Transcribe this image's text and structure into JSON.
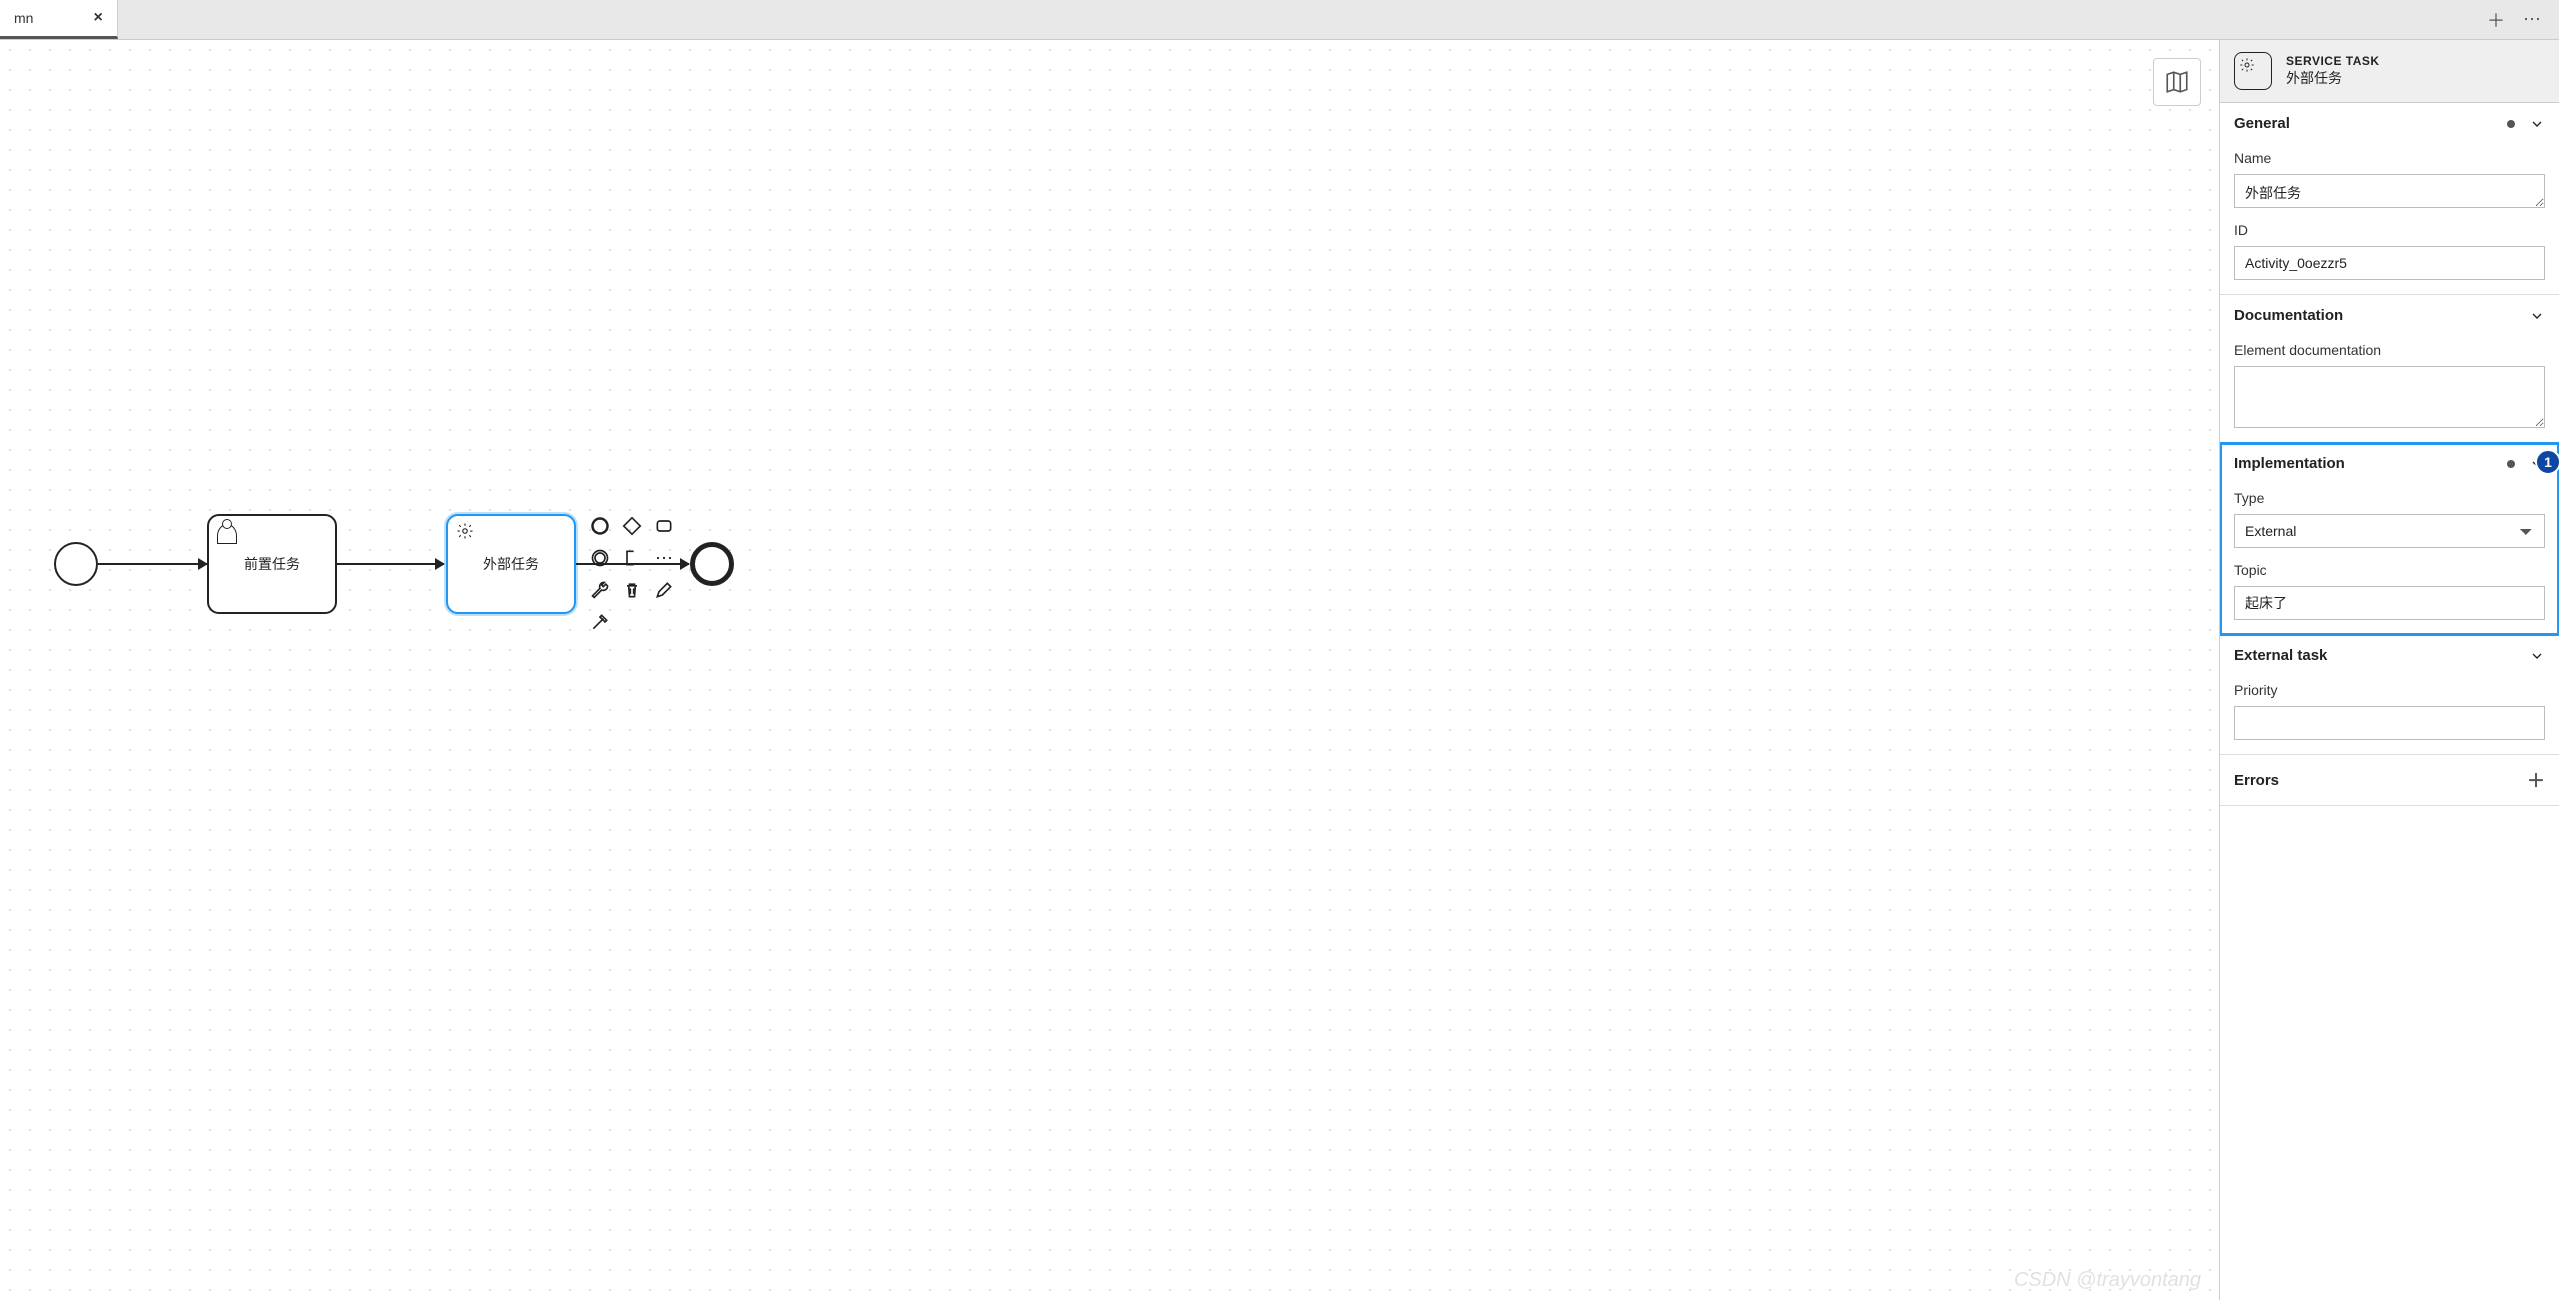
{
  "tab": {
    "label": "mn"
  },
  "diagram": {
    "task1_label": "前置任务",
    "task2_label": "外部任务"
  },
  "header": {
    "type": "SERVICE TASK",
    "name": "外部任务"
  },
  "sections": {
    "general": {
      "title": "General",
      "name_label": "Name",
      "name_value": "外部任务",
      "id_label": "ID",
      "id_value": "Activity_0oezzr5"
    },
    "documentation": {
      "title": "Documentation",
      "eldoc_label": "Element documentation",
      "eldoc_value": ""
    },
    "implementation": {
      "title": "Implementation",
      "badge": "1",
      "type_label": "Type",
      "type_value": "External",
      "topic_label": "Topic",
      "topic_value": "起床了"
    },
    "external_task": {
      "title": "External task",
      "priority_label": "Priority",
      "priority_value": ""
    },
    "errors": {
      "title": "Errors"
    }
  },
  "watermark": "CSDN @trayvontang"
}
